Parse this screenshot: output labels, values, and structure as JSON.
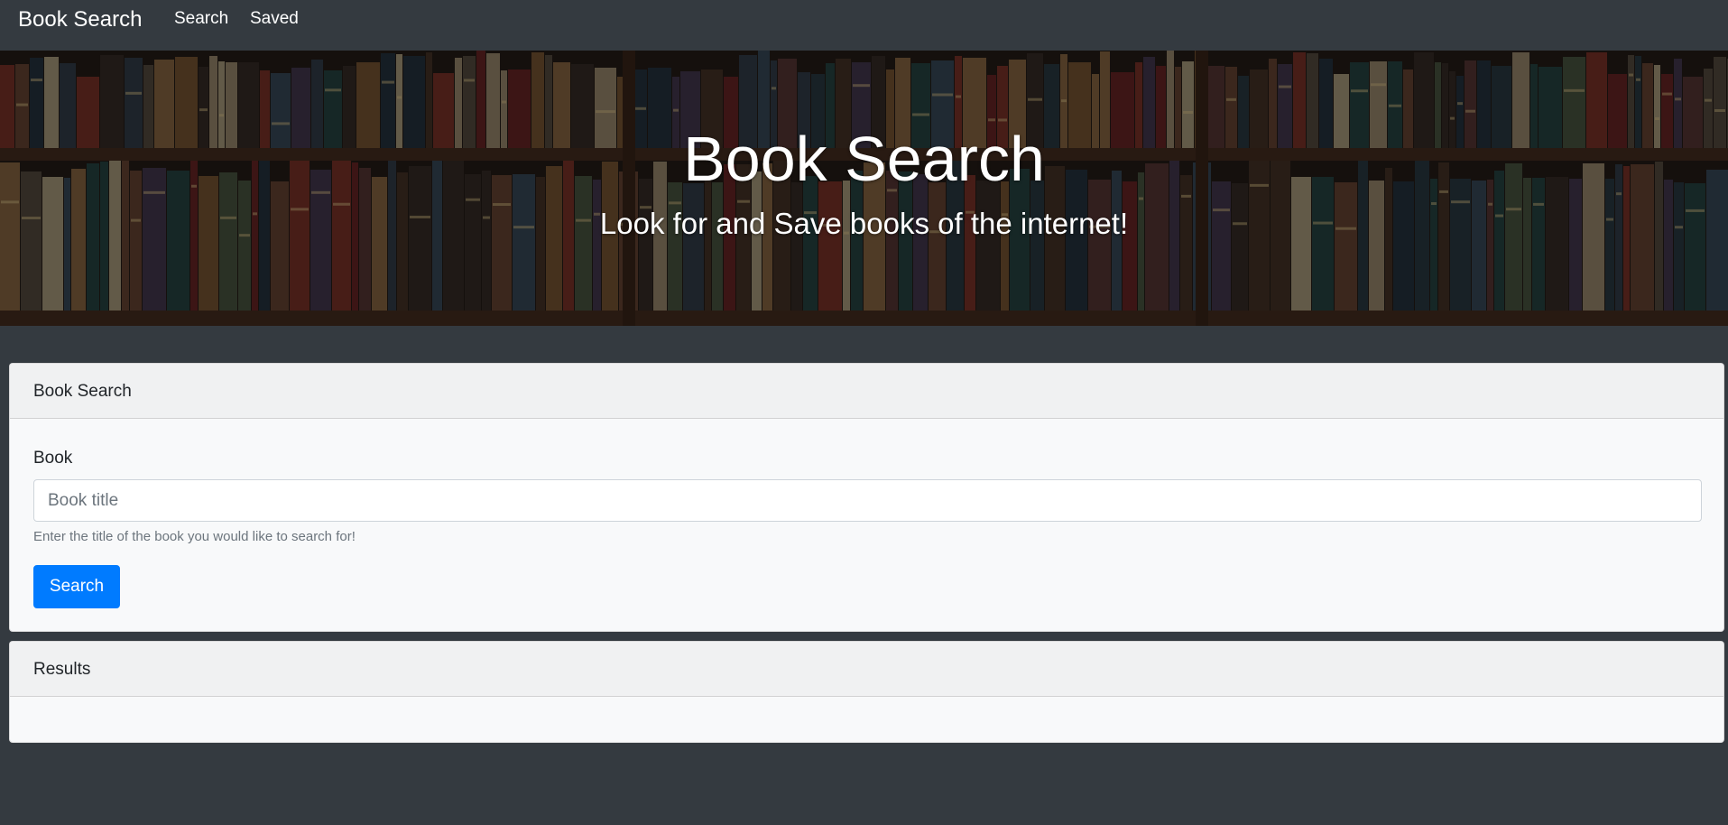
{
  "navbar": {
    "brand": "Book Search",
    "links": [
      {
        "label": "Search"
      },
      {
        "label": "Saved"
      }
    ]
  },
  "hero": {
    "title": "Book Search",
    "subtitle": "Look for and Save books of the internet!"
  },
  "search_card": {
    "header": "Book Search",
    "label": "Book",
    "input_value": "",
    "input_placeholder": "Book title",
    "help_text": "Enter the title of the book you would like to search for!",
    "button_label": "Search",
    "button_color": "#007bff"
  },
  "results_card": {
    "header": "Results"
  },
  "colors": {
    "page_background": "#343a40",
    "card_background": "#f8f9fa",
    "text": "#212529",
    "muted_text": "#6c757d"
  }
}
